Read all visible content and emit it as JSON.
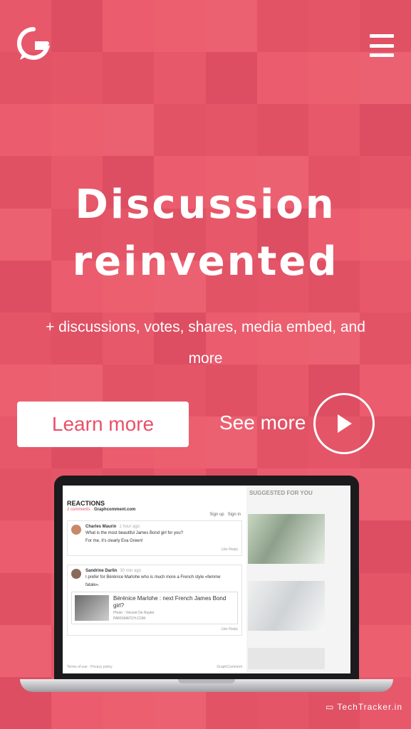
{
  "header": {
    "logo_icon": "graphcomment-logo-icon",
    "menu_icon": "hamburger-menu-icon"
  },
  "hero": {
    "title_line1": "Discussion",
    "title_line2": "reinvented",
    "subtitle": "+ discussions, votes, shares, media embed, and more"
  },
  "actions": {
    "learn_more": "Learn more",
    "see_more": "See more",
    "play_icon": "play-icon"
  },
  "preview": {
    "reactions_title": "REACTIONS",
    "comments_count": "2 comments",
    "site": "Graphcomment.com",
    "sign_up": "Sign up",
    "sign_in": "Sign in",
    "comment1": {
      "author": "Charles Maurin",
      "time": "1 hour ago",
      "text_line1": "What is the most beautiful James Bond girl for you?",
      "text_line2": "For me, it's clearly Eva Green!",
      "actions": "Like   Reply"
    },
    "comment2": {
      "author": "Sandrine Darlin",
      "time": "30 min ago",
      "text_line1": "I prefer for Bérénice Marlohe who is much more a French style «femme",
      "text_line2": "fatale».",
      "embed_title": "Bérénice Marlohe : next French James Bond girl?",
      "embed_credit": "Photo : Vincent De Ruyter",
      "embed_source": "PARISMATCH.COM",
      "actions": "Like   Reply"
    },
    "footer_left": "Terms of use · Privacy policy",
    "footer_right": "GraphComment",
    "suggested_label": "SUGGESTED FOR YOU"
  },
  "watermark": "TechTracker.in",
  "colors": {
    "brand": "#ee4f6a",
    "button_text": "#e9506a",
    "white": "#ffffff"
  }
}
